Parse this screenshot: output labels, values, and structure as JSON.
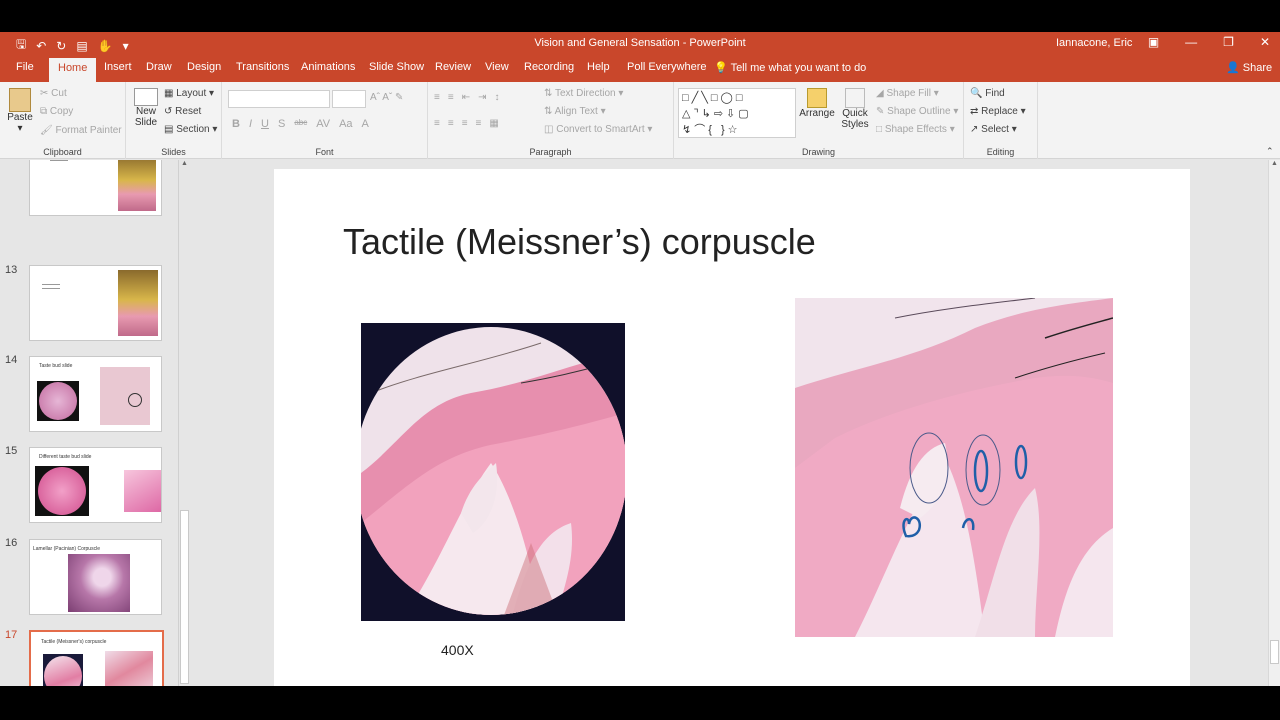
{
  "window": {
    "doc_title": "Vision and General Sensation  -  PowerPoint",
    "user": "Iannacone, Eric"
  },
  "tabs": [
    "File",
    "Home",
    "Insert",
    "Draw",
    "Design",
    "Transitions",
    "Animations",
    "Slide Show",
    "Review",
    "View",
    "Recording",
    "Help",
    "Poll Everywhere"
  ],
  "active_tab": "Home",
  "tell_me": "Tell me what you want to do",
  "share": "Share",
  "ribbon": {
    "clipboard": {
      "paste": "Paste",
      "cut": "Cut",
      "copy": "Copy",
      "format_painter": "Format Painter",
      "label": "Clipboard"
    },
    "slides": {
      "new_slide_1": "New",
      "new_slide_2": "Slide",
      "layout": "Layout",
      "reset": "Reset",
      "section": "Section",
      "label": "Slides"
    },
    "font": {
      "label": "Font",
      "bold": "B",
      "italic": "I",
      "underline": "U",
      "shadow": "S",
      "strike": "abc",
      "spacing": "AV",
      "case": "Aa",
      "color": "A"
    },
    "paragraph": {
      "text_direction": "Text Direction",
      "align_text": "Align Text",
      "convert": "Convert to SmartArt",
      "label": "Paragraph"
    },
    "drawing": {
      "arrange": "Arrange",
      "quick_styles_1": "Quick",
      "quick_styles_2": "Styles",
      "shape_fill": "Shape Fill",
      "shape_outline": "Shape Outline",
      "shape_effects": "Shape Effects",
      "label": "Drawing"
    },
    "editing": {
      "find": "Find",
      "replace": "Replace",
      "select": "Select",
      "label": "Editing"
    }
  },
  "thumbnails": [
    {
      "num": "",
      "title": ""
    },
    {
      "num": "13",
      "title": ""
    },
    {
      "num": "14",
      "title": "Taste bud slide"
    },
    {
      "num": "15",
      "title": "Different taste bud slide"
    },
    {
      "num": "16",
      "title": "Lamellar (Pacinian) Corpuscle"
    },
    {
      "num": "17",
      "title": "Tactile (Meissner's) corpuscle"
    }
  ],
  "slide": {
    "title": "Tactile (Meissner’s) corpuscle",
    "caption": "400X"
  },
  "colors": {
    "accent": "#c9472b",
    "selected_border": "#e46c4a"
  }
}
